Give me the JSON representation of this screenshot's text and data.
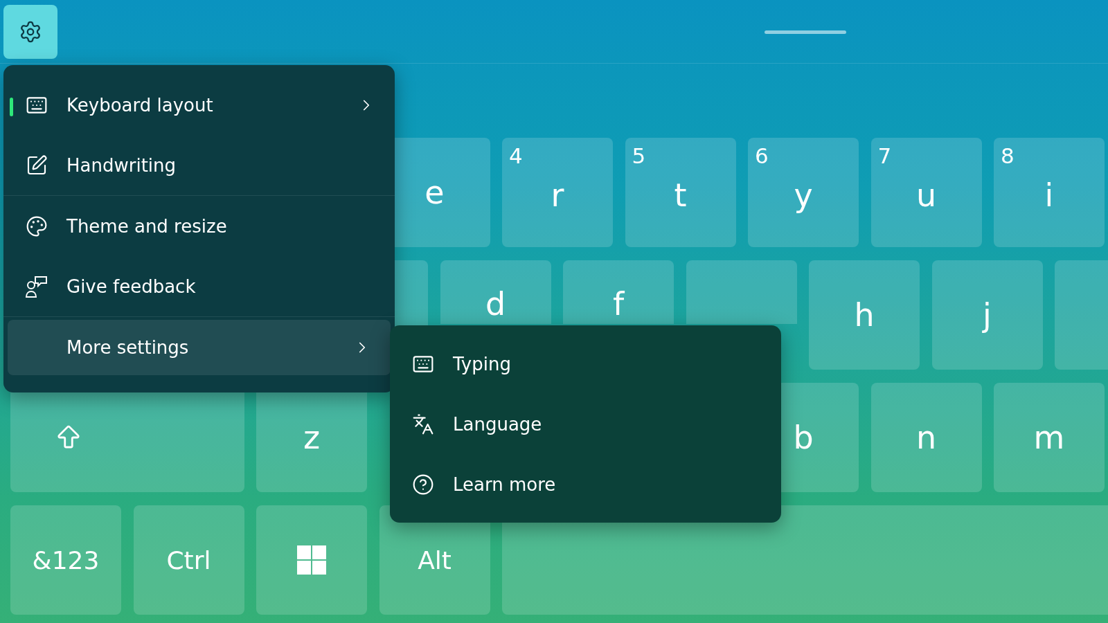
{
  "top_bar": {
    "settings_button": {
      "selected": true
    }
  },
  "keyboard": {
    "rows": [
      {
        "keys": [
          {
            "kind": "letter",
            "label": "e"
          },
          {
            "kind": "letter",
            "hint": "4",
            "label": "r"
          },
          {
            "kind": "letter",
            "hint": "5",
            "label": "t"
          },
          {
            "kind": "letter",
            "hint": "6",
            "label": "y"
          },
          {
            "kind": "letter",
            "hint": "7",
            "label": "u"
          },
          {
            "kind": "letter",
            "hint": "8",
            "label": "i"
          }
        ]
      },
      {
        "keys": [
          {
            "kind": "letter"
          },
          {
            "kind": "letter",
            "label": "d"
          },
          {
            "kind": "letter",
            "label": "f"
          },
          {
            "kind": "letter"
          },
          {
            "kind": "letter",
            "label": "h"
          },
          {
            "kind": "letter",
            "label": "j"
          },
          {
            "kind": "letter"
          }
        ]
      },
      {
        "keys": [
          {
            "kind": "shift"
          },
          {
            "kind": "letter",
            "label": "z"
          },
          {
            "kind": "letter",
            "label": "b"
          },
          {
            "kind": "letter",
            "label": "n"
          },
          {
            "kind": "letter",
            "label": "m"
          }
        ]
      },
      {
        "keys": [
          {
            "kind": "text",
            "label": "&123"
          },
          {
            "kind": "text",
            "label": "Ctrl"
          },
          {
            "kind": "windows"
          },
          {
            "kind": "text",
            "label": "Alt"
          },
          {
            "kind": "space"
          }
        ]
      }
    ]
  },
  "settings_menu": {
    "groups": [
      [
        {
          "label": "Keyboard layout",
          "selected": true,
          "highlighted": false,
          "submenu": true
        },
        {
          "label": "Handwriting",
          "selected": false,
          "highlighted": false,
          "submenu": false
        }
      ],
      [
        {
          "label": "Theme and resize",
          "selected": false,
          "highlighted": false,
          "submenu": false
        },
        {
          "label": "Give feedback",
          "selected": false,
          "highlighted": false,
          "submenu": false
        }
      ],
      [
        {
          "label": "More settings",
          "selected": false,
          "highlighted": true,
          "submenu": true
        }
      ]
    ]
  },
  "more_settings_submenu": {
    "items": [
      {
        "label": "Typing"
      },
      {
        "label": "Language"
      },
      {
        "label": "Learn more"
      }
    ]
  }
}
